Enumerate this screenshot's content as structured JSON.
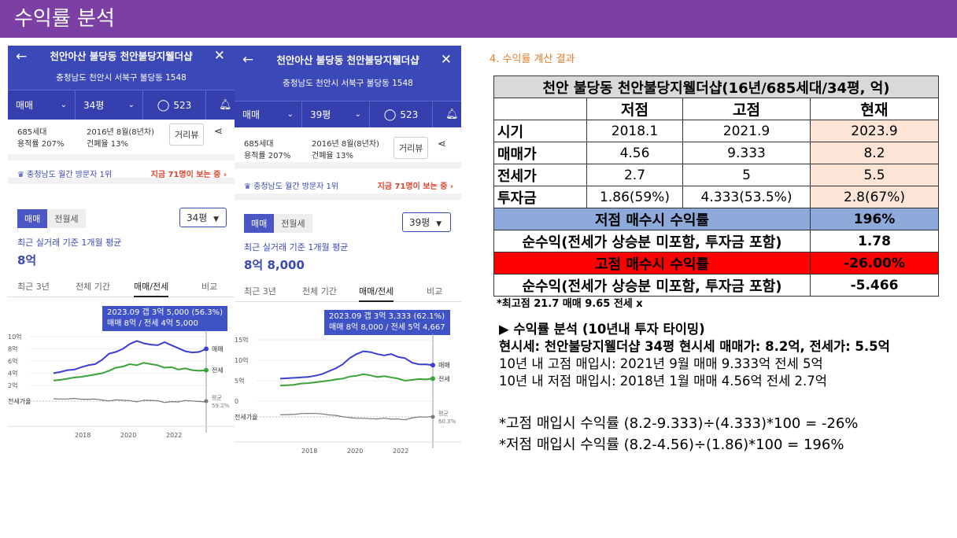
{
  "slide": {
    "title": "수익률 분석"
  },
  "phones": [
    {
      "name": "천안아산 불당동 천안불당지웰더샵",
      "address": "충청남도 천안시 서북구 불당동 1548",
      "filter": "매매",
      "size": "34평",
      "comments": "523",
      "units": "685세대",
      "ratio": "용적률 207%",
      "built": "2016년 8월(8년차)",
      "coverage": "건폐율 13%",
      "view_btn": "거리뷰",
      "rank": "충청남도 월간 방문자 1위",
      "now": "지금 71명이 보는 중 ›",
      "tab_sale": "매매",
      "tab_rent": "전월세",
      "size_select": "34평",
      "avg_label": "최근 실거래 기준 1개월 평균",
      "avg_price": "8억",
      "tabs": [
        "최근 3년",
        "전체 기간",
        "매매/전세",
        "비교"
      ],
      "tooltip1": "2023.09  갭 3억 5,000 (56.3%)",
      "tooltip2": "매매 8억 / 전세 4억 5,000",
      "y_ticks": [
        "10억",
        "8억",
        "6억",
        "4억",
        "2억"
      ],
      "y_max": 10,
      "y_min": 2,
      "ratio_label": "전세가율",
      "avg_ratio": "평균",
      "avg_ratio_val": "59.2%",
      "legend_sale": "매매",
      "legend_jeonse": "전세",
      "x_ticks": [
        "2018",
        "2020",
        "2022"
      ],
      "sale_series": [
        4.0,
        4.2,
        4.5,
        4.6,
        5.0,
        5.3,
        5.5,
        6.2,
        7.2,
        7.5,
        8.0,
        8.8,
        9.3,
        8.9,
        8.7,
        8.6,
        9.1,
        8.6,
        8.1,
        7.6,
        7.4,
        7.5,
        8.0
      ],
      "jeonse_series": [
        2.8,
        2.9,
        3.1,
        3.3,
        3.4,
        3.6,
        3.8,
        4.0,
        4.4,
        4.9,
        5.1,
        5.5,
        5.3,
        5.7,
        5.5,
        5.3,
        4.9,
        5.0,
        4.6,
        4.8,
        4.5,
        4.4,
        4.5
      ]
    },
    {
      "name": "천안아산 불당동 천안불당지웰더샵",
      "address": "충청남도 천안시 서북구 불당동 1548",
      "filter": "매매",
      "size": "39평",
      "comments": "523",
      "units": "685세대",
      "ratio": "용적률 207%",
      "built": "2016년 8월(8년차)",
      "coverage": "건폐율 13%",
      "view_btn": "거리뷰",
      "rank": "충청남도 월간 방문자 1위",
      "now": "지금 71명이 보는 중 ›",
      "tab_sale": "매매",
      "tab_rent": "전월세",
      "size_select": "39평",
      "avg_label": "최근 실거래 기준 1개월 평균",
      "avg_price": "8억 8,000",
      "tabs": [
        "최근 3년",
        "전체 기간",
        "매매/전세",
        "비교"
      ],
      "tooltip1": "2023.09  갭 3억 3,333 (62.1%)",
      "tooltip2": "매매 8억 8,000 / 전세 5억 4,667",
      "y_ticks": [
        "15억",
        "10억",
        "5억",
        "0"
      ],
      "y_max": 15,
      "y_min": 0,
      "ratio_label": "전세가율",
      "avg_ratio": "평균",
      "avg_ratio_val": "60.3%",
      "legend_sale": "매매",
      "legend_jeonse": "전세",
      "x_ticks": [
        "2018",
        "2020",
        "2022"
      ],
      "sale_series": [
        5.5,
        5.6,
        5.7,
        5.8,
        5.9,
        6.2,
        6.6,
        7.3,
        8.0,
        9.0,
        10.5,
        11.5,
        12.2,
        12.0,
        11.5,
        11.2,
        11.5,
        10.8,
        10.5,
        9.4,
        9.0,
        9.0,
        8.8
      ],
      "jeonse_series": [
        3.8,
        3.9,
        4.0,
        4.3,
        4.4,
        4.6,
        4.8,
        5.0,
        5.3,
        5.5,
        6.0,
        6.2,
        6.6,
        6.3,
        5.9,
        6.1,
        5.8,
        5.5,
        5.0,
        5.2,
        5.4,
        5.3,
        5.5
      ]
    }
  ],
  "analysis": {
    "section_title": "4. 수익률 계산 결과",
    "table_title": "천안 불당동 천안불당지웰더샵(16년/685세대/34평, 억)",
    "headers": [
      "",
      "저점",
      "고점",
      "현재"
    ],
    "rows": [
      [
        "시기",
        "2018.1",
        "2021.9",
        "2023.9"
      ],
      [
        "매매가",
        "4.56",
        "9.333",
        "8.2"
      ],
      [
        "전세가",
        "2.7",
        "5",
        "5.5"
      ],
      [
        "투자금",
        "1.86(59%)",
        "4.333(53.5%)",
        "2.8(67%)"
      ]
    ],
    "low_label": "저점 매수시 수익률",
    "low_value": "196%",
    "net_label": "순수익(전세가 상승분 미포함, 투자금 포함)",
    "low_net": "1.78",
    "high_label": "고점 매수시 수익률",
    "high_value": "-26.00%",
    "high_net": "-5.466",
    "footnote": "*최고점 21.7 매매 9.65 전세 x",
    "bullet_title": "▶ 수익률 분석 (10년내 투자 타이밍)",
    "line1": "현시세: 천안불당지웰더샵 34평 현시세 매매가: 8.2억, 전세가: 5.5억",
    "line2": "10년 내 고점 매입시: 2021년 9월 매매 9.333억 전세 5억",
    "line3": "10년 내 저점 매입시: 2018년 1월 매매 4.56억 전세 2.7억",
    "formula1": "*고점 매입시 수익률 (8.2-9.333)÷(4.333)*100  = -26%",
    "formula2": "*저점 매입시 수익률 (8.2-4.56)÷(1.86)*100  = 196%"
  },
  "colors": {
    "header": "#7b3fa5",
    "phone_blue": "#3b48b8",
    "sale_line": "#3b3fd1",
    "jeonse_line": "#3aa33a",
    "accent_orange": "#e97b2a"
  }
}
